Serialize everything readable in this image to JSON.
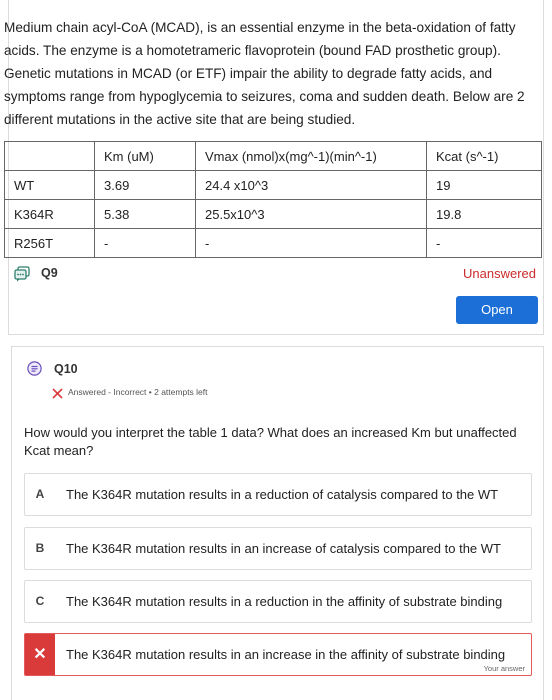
{
  "intro": {
    "text": "Medium chain acyl-CoA (MCAD), is an essential enzyme in the beta-oxidation of fatty acids. The enzyme is a homotetrameric flavoprotein (bound FAD prosthetic group). Genetic mutations in MCAD (or ETF) impair the ability to degrade fatty acids, and symptoms range from hypoglycemia to seizures, coma and sudden death. Below are 2 different mutations in the active site that are being studied."
  },
  "table": {
    "headers": [
      "",
      "Km (uM)",
      "Vmax (nmol)x(mg^-1)(min^-1)",
      "Kcat (s^-1)"
    ],
    "rows": [
      [
        "WT",
        "3.69",
        "24.4 x10^3",
        "19"
      ],
      [
        "K364R",
        "5.38",
        "25.5x10^3",
        "19.8"
      ],
      [
        "R256T",
        "-",
        "-",
        "-"
      ]
    ]
  },
  "q9": {
    "label": "Q9",
    "status": "Unanswered",
    "open_label": "Open",
    "icon": "chat-icon"
  },
  "q10": {
    "label": "Q10",
    "icon": "list-icon",
    "status": "Answered - Incorrect • 2 attempts left",
    "question": "How would you interpret the table 1 data? What does an increased Km but unaffected Kcat mean?",
    "options": [
      {
        "letter": "A",
        "text": "The K364R mutation results in a reduction of catalysis compared to the WT"
      },
      {
        "letter": "B",
        "text": "The K364R mutation results in an increase of catalysis compared to the WT"
      },
      {
        "letter": "C",
        "text": "The K364R mutation results in a reduction in the affinity of substrate binding"
      },
      {
        "letter": "✕",
        "text": "The K364R mutation results in an increase in the affinity of substrate binding",
        "note": "Your answer"
      }
    ]
  },
  "colors": {
    "primary": "#1b6fd6",
    "error": "#d93a3a",
    "status_red": "#cc2b2b",
    "q10_icon": "#6b4fbb"
  }
}
